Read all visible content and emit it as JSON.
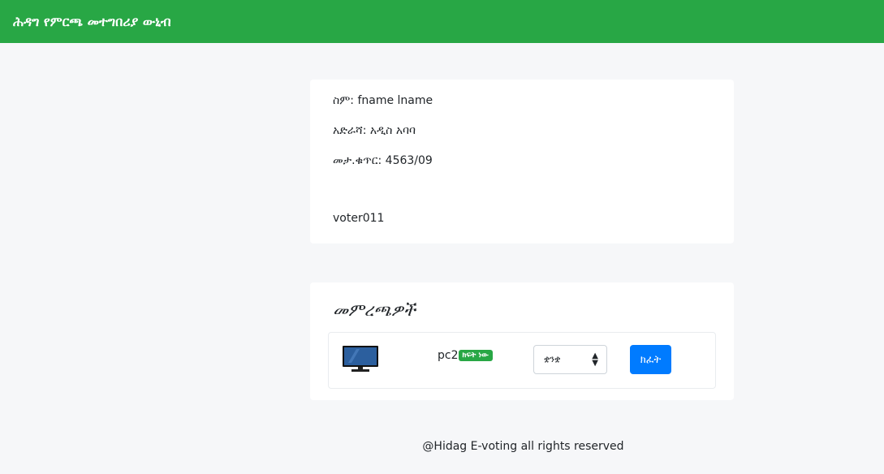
{
  "header": {
    "title": "ሕዳግ የምርጫ መተግበሪያ ውኒብ"
  },
  "profile": {
    "name": "ስም: fname lname",
    "address": "አድራሻ: አዲስ አባባ",
    "id_number": "መታ.ቁጥር: 4563/09",
    "username": "voter011"
  },
  "elections": {
    "heading": "መምረጫዎች",
    "items": [
      {
        "name": "pc2",
        "status": "ክፍት ነው",
        "select_value": "ቋንቋ",
        "button": "ክፈት",
        "icon": "monitor-icon"
      }
    ]
  },
  "footer": {
    "text": "@Hidag E-voting all rights reserved"
  },
  "colors": {
    "brand": "#28a745",
    "primary": "#007bff"
  }
}
